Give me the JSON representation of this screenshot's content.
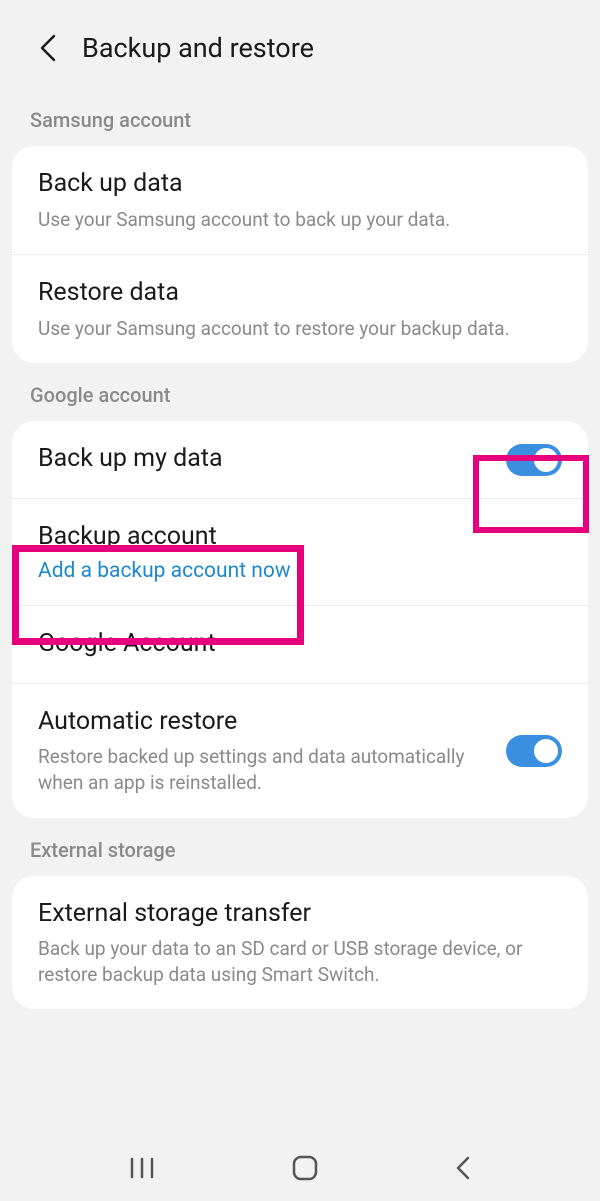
{
  "header": {
    "title": "Backup and restore"
  },
  "sections": {
    "samsung": {
      "label": "Samsung account",
      "backup": {
        "title": "Back up data",
        "subtitle": "Use your Samsung account to back up your data."
      },
      "restore": {
        "title": "Restore data",
        "subtitle": "Use your Samsung account to restore your backup data."
      }
    },
    "google": {
      "label": "Google account",
      "backupMyData": {
        "title": "Back up my data",
        "enabled": true
      },
      "backupAccount": {
        "title": "Backup account",
        "subtitle": "Add a backup account now"
      },
      "googleAccount": {
        "title": "Google Account"
      },
      "automaticRestore": {
        "title": "Automatic restore",
        "subtitle": "Restore backed up settings and data automatically when an app is reinstalled.",
        "enabled": true
      }
    },
    "external": {
      "label": "External storage",
      "transfer": {
        "title": "External storage transfer",
        "subtitle": "Back up your data to an SD card or USB storage device, or restore backup data using Smart Switch."
      }
    }
  }
}
